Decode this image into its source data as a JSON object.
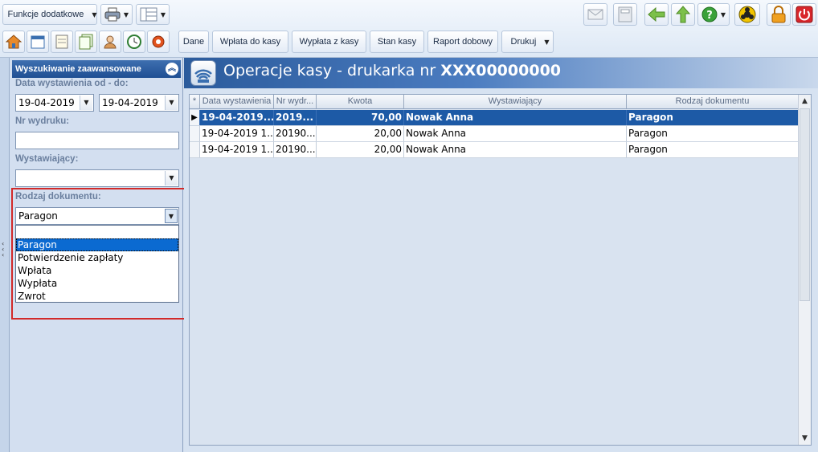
{
  "toolbar": {
    "funkcje_label": "Funkcje dodatkowe",
    "tabs": [
      "Dane",
      "Wpłata do kasy",
      "Wypłata z kasy",
      "Stan kasy",
      "Raport dobowy",
      "Drukuj"
    ]
  },
  "search": {
    "header": "Wyszukiwanie zaawansowane",
    "date_label": "Data wystawienia od - do:",
    "date_from": "19-04-2019",
    "date_to": "19-04-2019",
    "nr_label": "Nr wydruku:",
    "nr_value": "",
    "wyst_label": "Wystawiający:",
    "wyst_value": "",
    "rodzaj_label": "Rodzaj dokumentu:",
    "rodzaj_value": "Paragon",
    "rodzaj_options": [
      "",
      "Paragon",
      "Potwierdzenie zapłaty",
      "Wpłata",
      "Wypłata",
      "Zwrot"
    ]
  },
  "main": {
    "title_prefix": "Operacje kasy - drukarka nr ",
    "title_number": "XXX00000000",
    "columns": [
      "Data wystawienia",
      "Nr wydr...",
      "Kwota",
      "Wystawiający",
      "Rodzaj dokumentu"
    ],
    "rows": [
      [
        "19-04-2019...",
        "2019...",
        "70,00",
        "Nowak Anna",
        "Paragon"
      ],
      [
        "19-04-2019 1...",
        "20190...",
        "20,00",
        "Nowak Anna",
        "Paragon"
      ],
      [
        "19-04-2019 1...",
        "20190...",
        "20,00",
        "Nowak Anna",
        "Paragon"
      ]
    ]
  },
  "colors": {
    "accent": "#1f4f93",
    "selection": "#0b6ad1",
    "highlight": "#d22a2a"
  },
  "icons": [
    "home-icon",
    "calendar-icon",
    "notes-icon",
    "documents-icon",
    "users-icon",
    "clock-icon",
    "settings-icon",
    "printer-icon",
    "layout-icon",
    "mail-icon",
    "calculator-icon",
    "back-arrow-icon",
    "up-arrow-icon",
    "help-icon",
    "biohazard-icon",
    "lock-icon",
    "power-icon",
    "cash-register-icon"
  ]
}
